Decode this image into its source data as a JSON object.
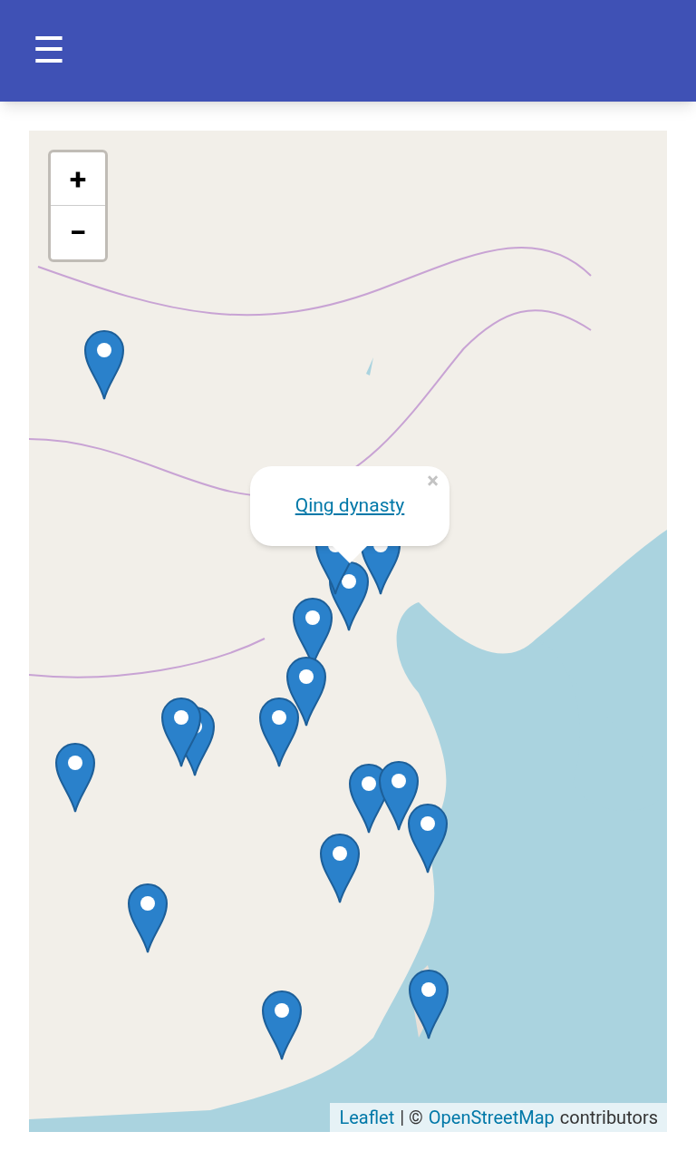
{
  "app_bar": {
    "menu": "☰"
  },
  "map": {
    "zoom_in": "+",
    "zoom_out": "−",
    "popup": {
      "link": "Qing dynasty",
      "close": "×"
    },
    "attribution": {
      "leaflet": "Leaflet",
      "separator": "| ©",
      "osm": "OpenStreetMap",
      "suffix": "contributors"
    }
  }
}
